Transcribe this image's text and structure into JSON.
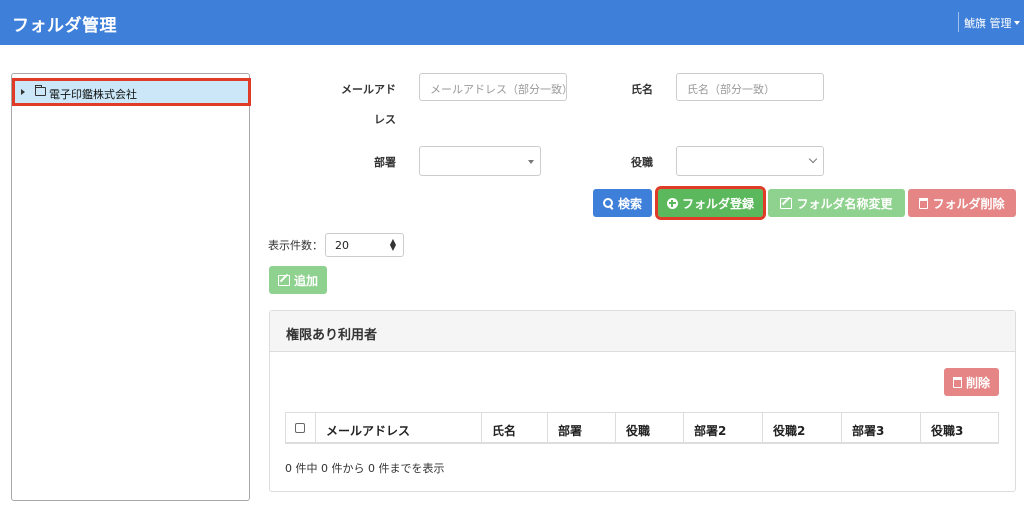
{
  "header": {
    "title": "フォルダ管理",
    "user_name": "鯱旗 管理"
  },
  "tree": {
    "root_label": "電子印鑑株式会社"
  },
  "search": {
    "email_label_line1": "メールアド",
    "email_label_line2": "レス",
    "email_placeholder": "メールアドレス（部分一致）",
    "name_label": "氏名",
    "name_placeholder": "氏名（部分一致）",
    "dept_label": "部署",
    "dept_value": "",
    "role_label": "役職",
    "role_value": ""
  },
  "toolbar": {
    "search_label": "検索",
    "register_label": "フォルダ登録",
    "rename_label": "フォルダ名称変更",
    "delete_label": "フォルダ削除"
  },
  "paging": {
    "count_label": "表示件数：",
    "count_value": "20"
  },
  "add_label": "追加",
  "panel": {
    "title": "権限あり利用者",
    "delete_label": "削除",
    "columns": [
      "メールアドレス",
      "氏名",
      "部署",
      "役職",
      "部署2",
      "役職2",
      "部署3",
      "役職3"
    ],
    "info": "0 件中 0 件から 0 件までを表示"
  },
  "colors": {
    "accent": "#3d7fd9",
    "success": "#5cb85c",
    "highlight": "#e03b26",
    "tree_selected": "#cce8f8"
  }
}
